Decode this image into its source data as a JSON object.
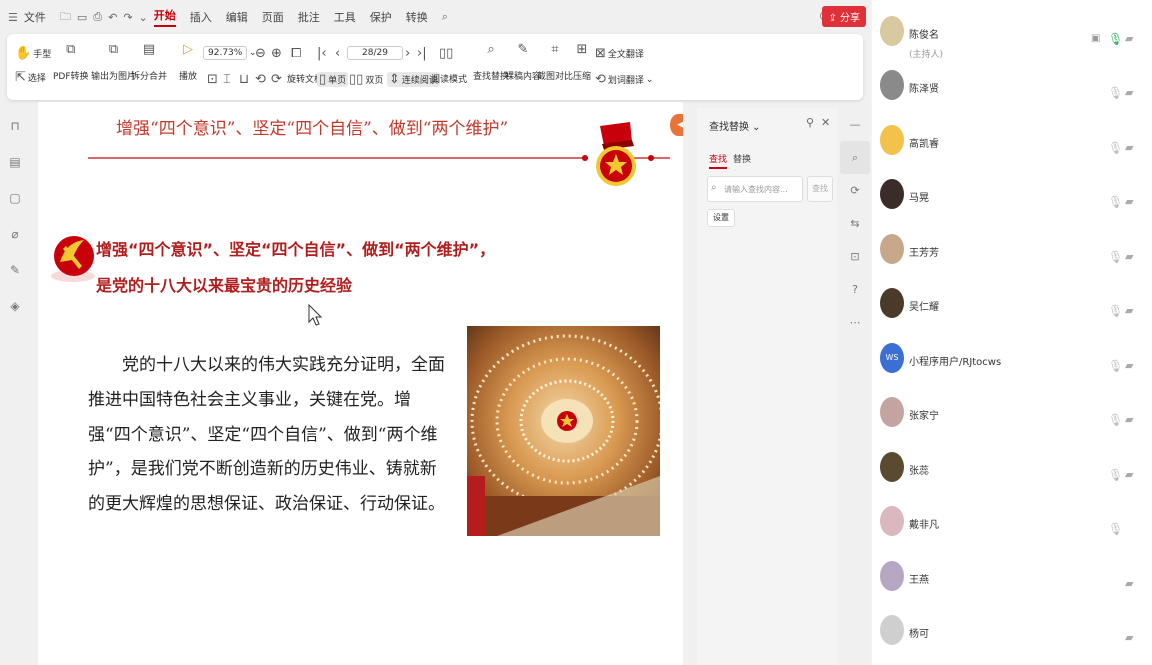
{
  "menubar": {
    "file_label": "文件",
    "items": [
      "开始",
      "插入",
      "编辑",
      "页面",
      "批注",
      "工具",
      "保护",
      "转换"
    ],
    "active_index": 0,
    "share_label": "分享"
  },
  "ribbon": {
    "hand_label": "手型",
    "select_label": "选择",
    "pdf_convert_label": "PDF转换",
    "export_image_label": "输出为图片",
    "split_merge_label": "拆分合并",
    "play_label": "播放",
    "zoom_value": "92.73%",
    "rotate_label": "旋转文档",
    "single_page_label": "单页",
    "double_page_label": "双页",
    "continuous_label": "连续阅读",
    "read_mode_label": "阅读模式",
    "page_value": "28/29",
    "find_replace_label": "查找替换",
    "cloud_content_label": "裸稿内容",
    "screenshot_compare_label": "截图对比",
    "compress_label": "压缩",
    "full_translate_label": "全文翻译",
    "word_translate_label": "划词翻译"
  },
  "document": {
    "header_title": "增强“四个意识”、坚定“四个自信”、做到“两个维护”",
    "section_title_1": "增强“四个意识”、坚定“四个自信”、做到“两个维护”，",
    "section_title_2": "是党的十八大以来最宝贵的历史经验",
    "body": "党的十八大以来的伟大实践充分证明，全面推进中国特色社会主义事业，关键在党。增强“四个意识”、坚定“四个自信”、做到“两个维护”，是我们党不断创造新的历史伟业、铸就新的更大辉煌的思想保证、政治保证、行动保证。"
  },
  "find_panel": {
    "title": "查找替换",
    "tab_find": "查找",
    "tab_replace": "替换",
    "input_placeholder": "请输入查找内容...",
    "find_button": "查找",
    "settings_button": "设置"
  },
  "participants": [
    {
      "name": "陈俊名",
      "role": "(主持人)",
      "mic": "on",
      "cam": "off",
      "screen": true,
      "avatar_color": "#d9c9a0"
    },
    {
      "name": "陈泽贤",
      "mic": "muted",
      "cam": "off",
      "avatar_color": "#8a8a8a"
    },
    {
      "name": "高凯睿",
      "mic": "muted",
      "cam": "off",
      "avatar_color": "#f2c24a"
    },
    {
      "name": "马晃",
      "mic": "muted",
      "cam": "off",
      "avatar_color": "#3a2c28"
    },
    {
      "name": "王芳芳",
      "mic": "muted",
      "cam": "off",
      "avatar_color": "#c7a88a"
    },
    {
      "name": "吴仁耀",
      "mic": "muted",
      "cam": "off",
      "avatar_color": "#4b3a2a"
    },
    {
      "name": "小程序用户/RJtocws",
      "mic": "muted",
      "cam": "off",
      "avatar_text": "WS",
      "avatar_color": "#3b6fd4"
    },
    {
      "name": "张家宁",
      "mic": "muted",
      "cam": "off",
      "avatar_color": "#c4a4a0"
    },
    {
      "name": "张蕊",
      "mic": "muted",
      "cam": "off",
      "avatar_color": "#5a4a30"
    },
    {
      "name": "戴非凡",
      "mic": "muted",
      "cam": "none",
      "avatar_color": "#d9b8c0"
    },
    {
      "name": "王燕",
      "mic": "none",
      "cam": "off",
      "avatar_color": "#b6a8c2"
    },
    {
      "name": "杨可",
      "mic": "none",
      "cam": "off",
      "avatar_color": "#cfcfcf"
    }
  ]
}
